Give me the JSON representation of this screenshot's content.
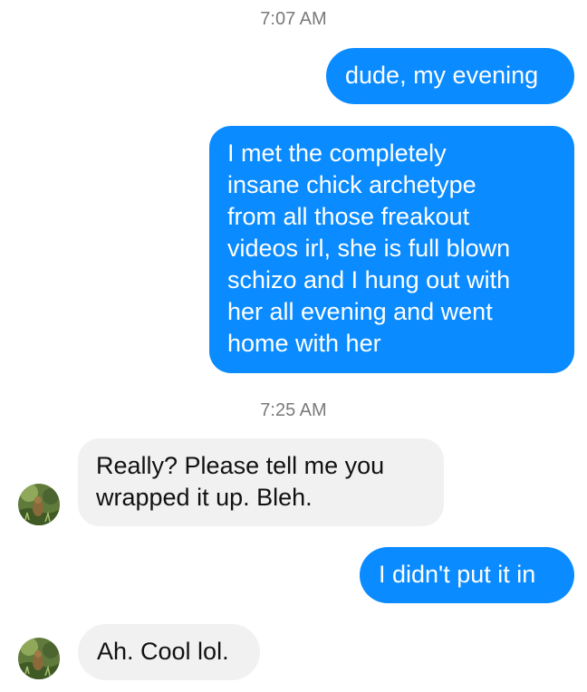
{
  "messages": [
    {
      "type": "timestamp",
      "text": "7:07 AM"
    },
    {
      "type": "outgoing",
      "text": "dude, my evening"
    },
    {
      "type": "outgoing",
      "text": "I met the completely\ninsane chick archetype\nfrom all those freakout\nvideos irl, she is full blown\nschizo and I hung out with\nher all evening and went\nhome with her"
    },
    {
      "type": "timestamp",
      "text": "7:25 AM"
    },
    {
      "type": "incoming",
      "text": "Really? Please tell me you\nwrapped it up. Bleh.",
      "avatar_icon": "contact-avatar"
    },
    {
      "type": "outgoing",
      "text": "I didn't put it in"
    },
    {
      "type": "incoming",
      "text": "Ah. Cool lol.",
      "avatar_icon": "contact-avatar"
    }
  ],
  "colors": {
    "outgoing_bubble": "#0a8bff",
    "outgoing_text": "#ffffff",
    "incoming_bubble": "#f1f1f1",
    "incoming_text": "#111111",
    "timestamp_text": "#7a7a7a"
  }
}
